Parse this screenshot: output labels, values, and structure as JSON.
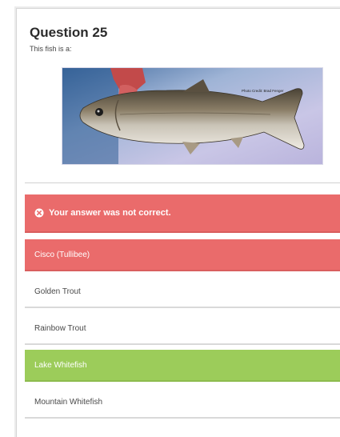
{
  "question": {
    "title": "Question 25",
    "prompt": "This fish is a:",
    "image_icon": "fish-photo",
    "image_credit": "Photo Credit: Brad Fenger"
  },
  "feedback": {
    "icon": "x-circle-icon",
    "message": "Your answer was not correct.",
    "color": "#ea6b6b"
  },
  "options": [
    {
      "label": "Cisco (Tullibee)",
      "state": "selected-wrong",
      "color": "#ea6b6b"
    },
    {
      "label": "Golden Trout",
      "state": "neutral"
    },
    {
      "label": "Rainbow Trout",
      "state": "neutral"
    },
    {
      "label": "Lake Whitefish",
      "state": "correct",
      "color": "#9ccc5a"
    },
    {
      "label": "Mountain Whitefish",
      "state": "neutral"
    }
  ]
}
